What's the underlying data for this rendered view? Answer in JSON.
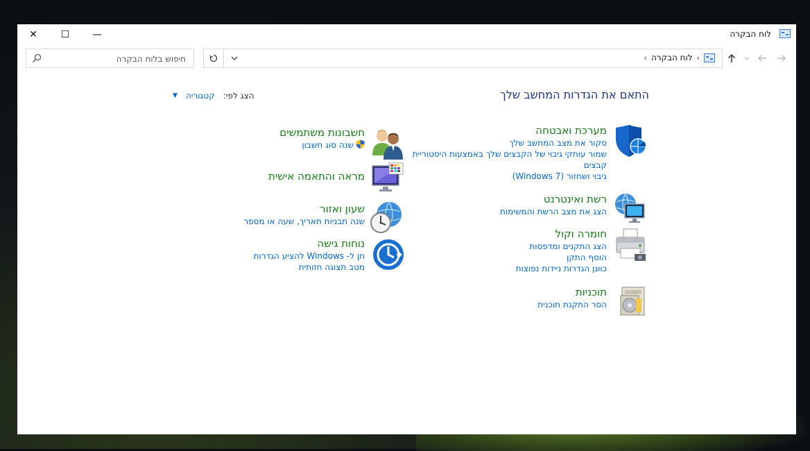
{
  "window": {
    "title": "לוח הבקרה",
    "controls": {
      "close": "✕",
      "maximize": "☐",
      "minimize": "—"
    }
  },
  "toolbar": {
    "search_placeholder": "חיפוש בלוח הבקרה",
    "breadcrumb": "לוח הבקרה",
    "breadcrumb_sep": "›"
  },
  "header": {
    "title": "התאם את הגדרות המחשב שלך",
    "view_by_label": "הצג לפי:",
    "view_by_value": "קטגוריה"
  },
  "categories": {
    "security": {
      "title": "מערכת ואבטחה",
      "links": [
        "סקור את מצב המחשב שלך",
        "שמור עותקי גיבוי של הקבצים שלך באמצעות היסטוריית קבצים",
        "גיבוי ושחזור (Windows 7)"
      ]
    },
    "network": {
      "title": "רשת ואינטרנט",
      "links": [
        "הצג את מצב הרשת והמשימות"
      ]
    },
    "hardware": {
      "title": "חומרה וקול",
      "links": [
        "הצג התקנים ומדפסות",
        "הוסף התקן",
        "כוונן הגדרות ניידות נפוצות"
      ]
    },
    "programs": {
      "title": "תוכניות",
      "links": [
        "הסר התקנת תוכנית"
      ]
    },
    "users": {
      "title": "חשבונות משתמשים",
      "links": [
        "שנה סוג חשבון"
      ]
    },
    "appearance": {
      "title": "מראה והתאמה אישית",
      "links": []
    },
    "clock": {
      "title": "שעון ואזור",
      "links": [
        "שנה תבניות תאריך, שעה או מספר"
      ]
    },
    "access": {
      "title": "נוחות גישה",
      "links": [
        "תן ל- Windows להציע הגדרות",
        "מטב תצוגה חזותית"
      ]
    }
  }
}
